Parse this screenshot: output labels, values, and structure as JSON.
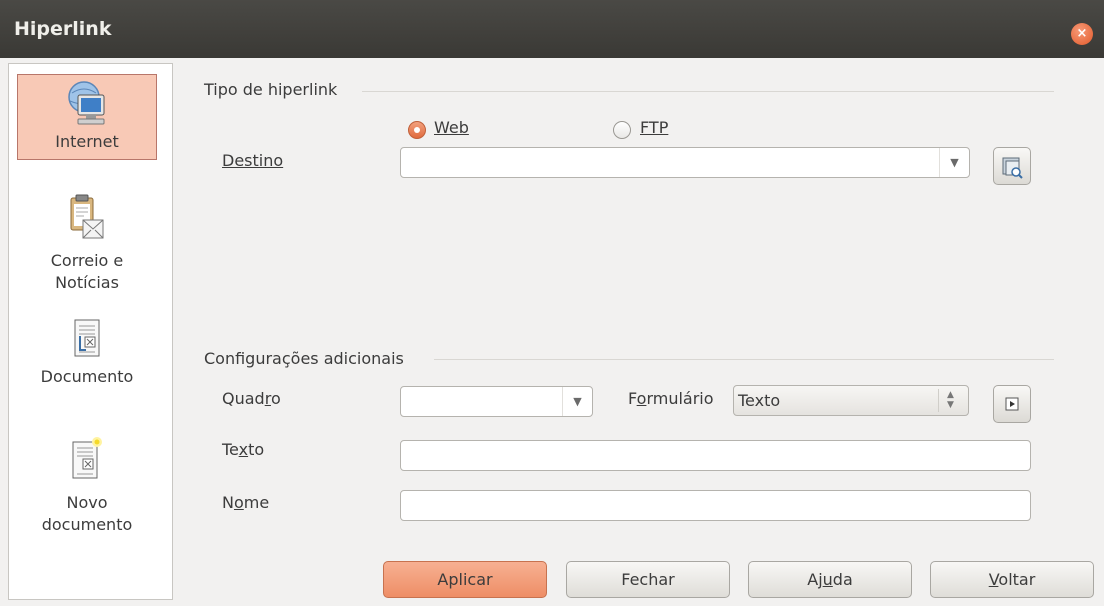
{
  "window": {
    "title": "Hiperlink",
    "close_icon": "×"
  },
  "sidebar": {
    "items": [
      {
        "label": "Internet",
        "icon": "globe-computer-icon",
        "active": true
      },
      {
        "label": "Correio e Notícias",
        "icon": "clipboard-mail-icon",
        "active": false
      },
      {
        "label": "Documento",
        "icon": "document-icon",
        "active": false
      },
      {
        "label": "Novo documento",
        "icon": "new-document-icon",
        "active": false
      }
    ]
  },
  "hyperlink_type": {
    "section_title": "Tipo de hiperlink",
    "options": [
      {
        "label": "Web",
        "selected": true
      },
      {
        "label": "FTP",
        "selected": false
      }
    ],
    "target_label": "Destino",
    "target_value": ""
  },
  "additional": {
    "section_title": "Configurações adicionais",
    "frame_label": "Quadro",
    "frame_value": "",
    "form_label": "Formulário",
    "form_value": "Texto",
    "text_label": "Texto",
    "text_value": "",
    "name_label": "Nome",
    "name_value": ""
  },
  "buttons": {
    "apply": "Aplicar",
    "close": "Fechar",
    "help": "Ajuda",
    "back": "Voltar"
  },
  "colors": {
    "accent": "#ee8e66",
    "titlebar": "#3c3b37",
    "selected_item": "#f8c9b6"
  }
}
